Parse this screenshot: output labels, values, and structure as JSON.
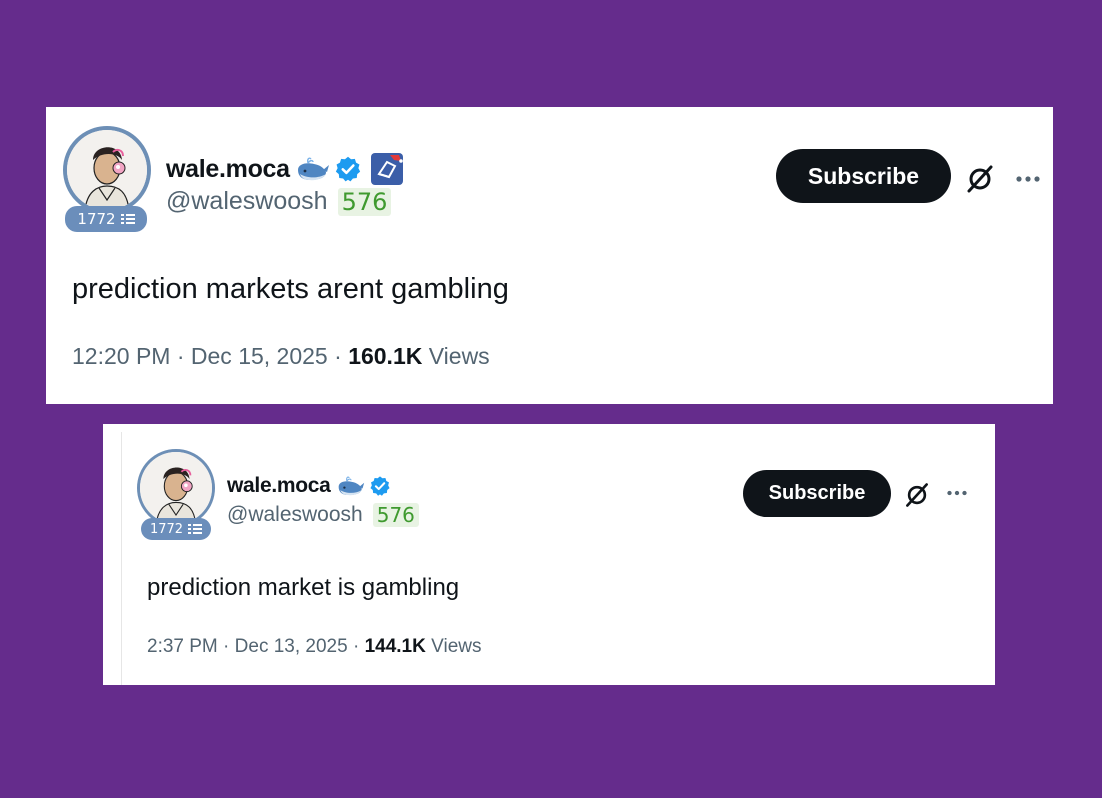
{
  "colors": {
    "background": "#652c8c",
    "card": "#ffffff",
    "subscribe_bg": "#0f1419",
    "handle_text": "#536471",
    "score_pill_text": "#3f9a2f",
    "score_pill_bg": "#e8f3e3",
    "badge_bg": "#6b8ebb",
    "verified": "#1d9bf0"
  },
  "tweets": [
    {
      "display_name": "wale.moca",
      "handle": "@waleswoosh",
      "score": "576",
      "avatar_badge": "1772",
      "icons": [
        "whale-emoji-icon",
        "verified-badge-icon",
        "org-affiliation-icon",
        "grok-icon",
        "more-icon"
      ],
      "subscribe_label": "Subscribe",
      "text": "prediction markets arent gambling",
      "time": "12:20 PM",
      "date": "Dec 15, 2025",
      "views_count": "160.1K",
      "views_label": "Views"
    },
    {
      "display_name": "wale.moca",
      "handle": "@waleswoosh",
      "score": "576",
      "avatar_badge": "1772",
      "icons": [
        "whale-emoji-icon",
        "verified-badge-icon",
        "grok-icon",
        "more-icon"
      ],
      "subscribe_label": "Subscribe",
      "text": "prediction market is gambling",
      "time": "2:37 PM",
      "date": "Dec 13, 2025",
      "views_count": "144.1K",
      "views_label": "Views"
    }
  ]
}
